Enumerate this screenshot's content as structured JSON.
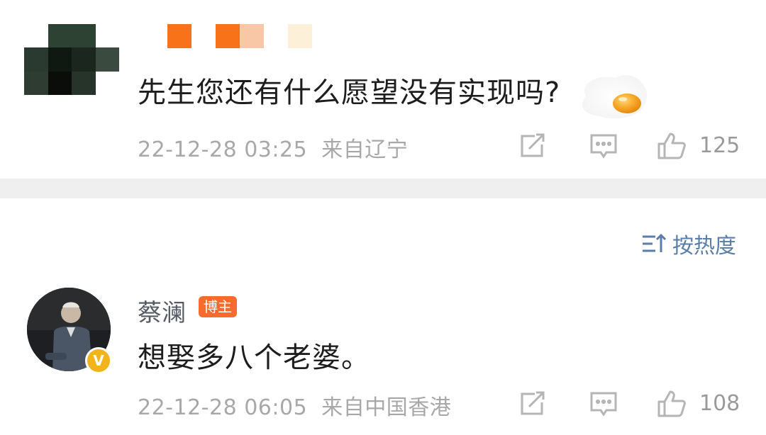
{
  "post": {
    "author_avatar": "pixelated-avatar",
    "author_name_censored": true,
    "text": "先生您还有什么愿望没有实现吗?",
    "sticker": "fried-egg",
    "time": "22-12-28 03:25",
    "location": "来自辽宁",
    "likes": "125",
    "icons": {
      "share": "share-icon",
      "comment": "comment-icon",
      "like": "thumbs-up-icon"
    }
  },
  "sort": {
    "label": "按热度",
    "icon": "sort-icon"
  },
  "comment": {
    "author": "蔡澜",
    "badge": "博主",
    "verified_mark": "V",
    "text": "想娶多八个老婆。",
    "time": "22-12-28 06:05",
    "location": "来自中国香港",
    "likes": "108"
  },
  "colors": {
    "link_blue": "#5a7ea8",
    "badge_orange": "#f76b2f",
    "verified_gold": "#f3b31a",
    "meta_gray": "#a8a8a8",
    "divider": "#efefef"
  }
}
